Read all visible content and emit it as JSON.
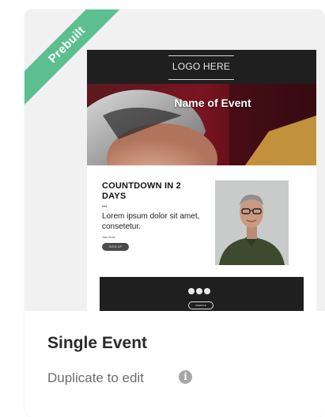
{
  "ribbon": {
    "label": "Prebuilt",
    "color": "#5bbf90"
  },
  "preview": {
    "logo_text": "LOGO HERE",
    "hero_title": "Name of Event",
    "countdown_title": "COUNTDOWN IN 2 DAYS",
    "dots": "•••",
    "lorem": "Lorem ipsum dolor sit amet, consetetur.",
    "small_text": "Join Now",
    "button_text": "SIGN UP",
    "footer_button": "WEBSITE",
    "social_icons": [
      "facebook-icon",
      "twitter-icon",
      "instagram-icon"
    ]
  },
  "card": {
    "title": "Single Event",
    "subtitle": "Duplicate to edit",
    "info_icon": "info-icon",
    "info_symbol": "i"
  }
}
